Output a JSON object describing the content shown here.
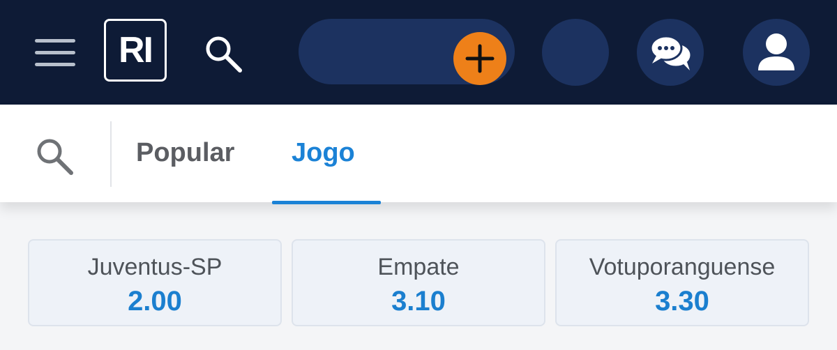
{
  "header": {
    "logo_text": "RI",
    "icons": {
      "menu": "hamburger-menu-icon",
      "search": "search-icon",
      "add": "plus-icon",
      "chat": "chat-bubbles-icon",
      "profile": "user-icon"
    },
    "colors": {
      "background": "#0e1b36",
      "pill": "#1c3260",
      "accent": "#ee8019"
    }
  },
  "tabs": {
    "items": [
      {
        "label": "Popular",
        "active": false
      },
      {
        "label": "Jogo",
        "active": true
      }
    ],
    "active_color": "#1b82d6"
  },
  "odds": [
    {
      "name": "Juventus-SP",
      "value": "2.00"
    },
    {
      "name": "Empate",
      "value": "3.10"
    },
    {
      "name": "Votuporanguense",
      "value": "3.30"
    }
  ]
}
